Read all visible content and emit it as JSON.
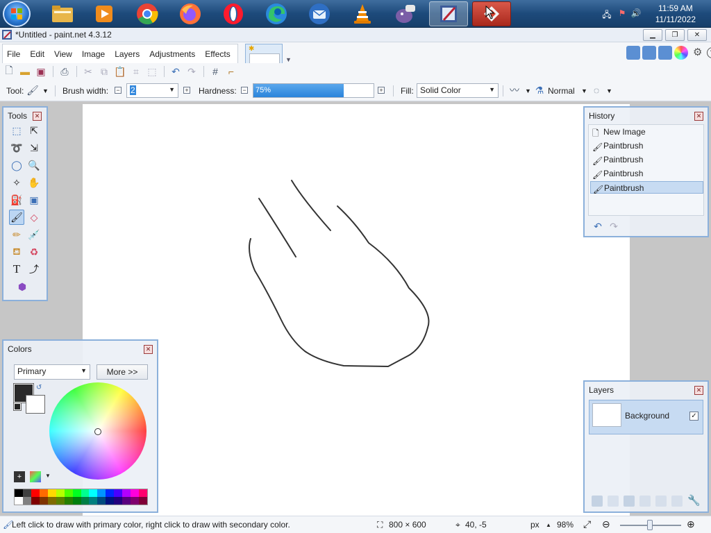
{
  "taskbar": {
    "clock_time": "11:59 AM",
    "clock_date": "11/11/2022",
    "apps": [
      {
        "name": "file-explorer",
        "color": "#e8b64a"
      },
      {
        "name": "media-player",
        "color": "#f08c1c"
      },
      {
        "name": "chrome",
        "color": "#ea4335"
      },
      {
        "name": "firefox",
        "color": "#ff7139"
      },
      {
        "name": "opera",
        "color": "#ff1b2d"
      },
      {
        "name": "edge",
        "color": "#2a8adc"
      },
      {
        "name": "thunderbird",
        "color": "#2f6fc4"
      },
      {
        "name": "vlc",
        "color": "#f28a00"
      },
      {
        "name": "pidgin",
        "color": "#7b5ea7"
      },
      {
        "name": "paint-net",
        "color": "#3c5b9a"
      },
      {
        "name": "anydesk",
        "color": "#d7402d"
      }
    ]
  },
  "window": {
    "title": "*Untitled - paint.net 4.3.12"
  },
  "menu": {
    "file": "File",
    "edit": "Edit",
    "view": "View",
    "image": "Image",
    "layers": "Layers",
    "adjustments": "Adjustments",
    "effects": "Effects"
  },
  "options": {
    "tool_label": "Tool:",
    "brush_width_label": "Brush width:",
    "brush_width_value": "2",
    "hardness_label": "Hardness:",
    "hardness_value": "75%",
    "hardness_fraction": 0.75,
    "fill_label": "Fill:",
    "fill_value": "Solid Color",
    "blend_mode": "Normal"
  },
  "tools_panel": {
    "title": "Tools"
  },
  "history_panel": {
    "title": "History",
    "items": [
      "New Image",
      "Paintbrush",
      "Paintbrush",
      "Paintbrush",
      "Paintbrush"
    ],
    "selected_index": 4
  },
  "colors_panel": {
    "title": "Colors",
    "mode": "Primary",
    "more_button": "More >>",
    "primary_color": "#2a2a2a",
    "secondary_color": "#ffffff",
    "palette_top": [
      "#000000",
      "#404040",
      "#ff0000",
      "#ff6a00",
      "#ffd800",
      "#b6ff00",
      "#4cff00",
      "#00ff21",
      "#00ff90",
      "#00ffff",
      "#0094ff",
      "#0026ff",
      "#4800ff",
      "#b200ff",
      "#ff00dc",
      "#ff006e"
    ],
    "palette_bottom": [
      "#ffffff",
      "#808080",
      "#7f0000",
      "#7f3300",
      "#7f6a00",
      "#5b7f00",
      "#267f00",
      "#007f0e",
      "#007f46",
      "#007f7f",
      "#004a7f",
      "#00137f",
      "#21007f",
      "#57007f",
      "#7f006e",
      "#7f0037"
    ]
  },
  "layers_panel": {
    "title": "Layers",
    "layers": [
      {
        "name": "Background",
        "visible": true
      }
    ]
  },
  "status": {
    "hint": "Left click to draw with primary color, right click to draw with secondary color.",
    "image_size": "800 × 600",
    "cursor_pos": "40, -5",
    "unit": "px",
    "zoom": "98%"
  }
}
